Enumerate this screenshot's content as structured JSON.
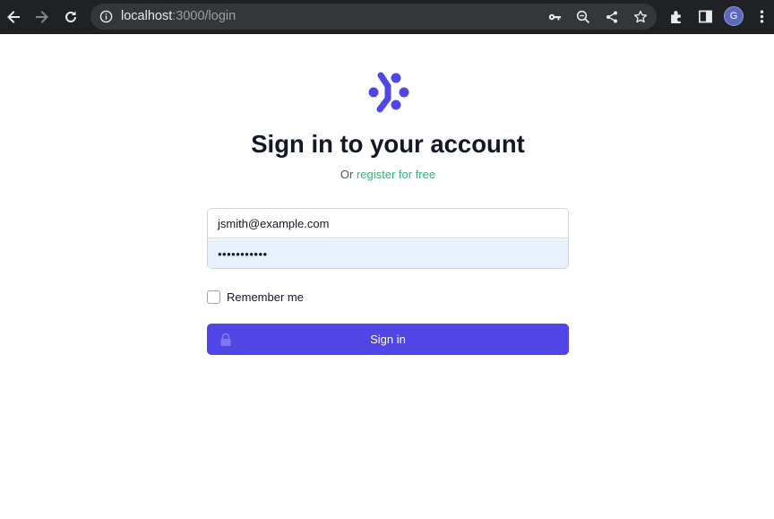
{
  "browser": {
    "url_host": "localhost",
    "url_path": ":3000/login",
    "avatar_initial": "G",
    "icons": [
      "back-arrow-icon",
      "forward-arrow-icon",
      "reload-icon",
      "info-icon",
      "key-icon",
      "zoom-icon",
      "share-icon",
      "star-icon",
      "extensions-icon",
      "side-panel-icon",
      "more-icon"
    ]
  },
  "login": {
    "title": "Sign in to your account",
    "subtitle_prefix": "Or",
    "register_link": "register for free",
    "email_value": "jsmith@example.com",
    "password_mask": "•••••••••••",
    "remember_label": "Remember me",
    "remember_checked": false,
    "signin_label": "Sign in"
  },
  "colors": {
    "brand": "#4f46e5",
    "link": "#34b27b",
    "autofill": "#e8f0fe"
  }
}
